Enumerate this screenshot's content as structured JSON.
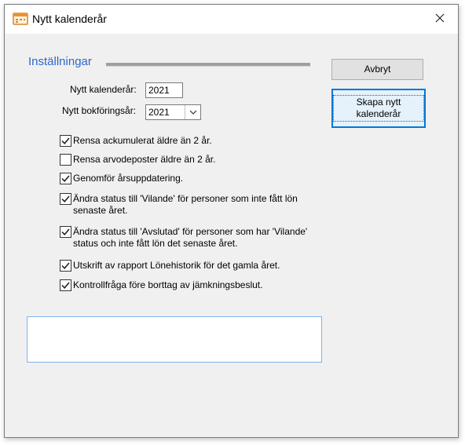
{
  "window": {
    "title": "Nytt kalenderår",
    "icon": "calendar-app-icon",
    "close_icon": "close-icon"
  },
  "settings": {
    "section_title": "Inställningar",
    "calendar_year_label": "Nytt kalenderår:",
    "calendar_year_value": "2021",
    "fiscal_year_label": "Nytt bokföringsår:",
    "fiscal_year_value": "2021"
  },
  "buttons": {
    "cancel": "Avbryt",
    "create": "Skapa nytt kalenderår"
  },
  "options": [
    {
      "label": "Rensa ackumulerat äldre än 2 år.",
      "checked": true
    },
    {
      "label": "Rensa arvodeposter äldre än 2 år.",
      "checked": false
    },
    {
      "label": "Genomför årsuppdatering.",
      "checked": true
    },
    {
      "label": "Ändra status till 'Vilande' för personer som inte fått lön senaste året.",
      "checked": true
    },
    {
      "label": "Ändra status till 'Avslutad' för personer som har 'Vilande' status och inte fått lön det senaste året.",
      "checked": true
    },
    {
      "label": "Utskrift av rapport Lönehistorik för det gamla året.",
      "checked": true
    },
    {
      "label": "Kontrollfråga före borttag av jämkningsbeslut.",
      "checked": true
    }
  ],
  "memo": {
    "text": ""
  },
  "colors": {
    "accent": "#2f66c9",
    "default_button_border": "#0078d7",
    "window_bg": "#f0f0f0"
  }
}
